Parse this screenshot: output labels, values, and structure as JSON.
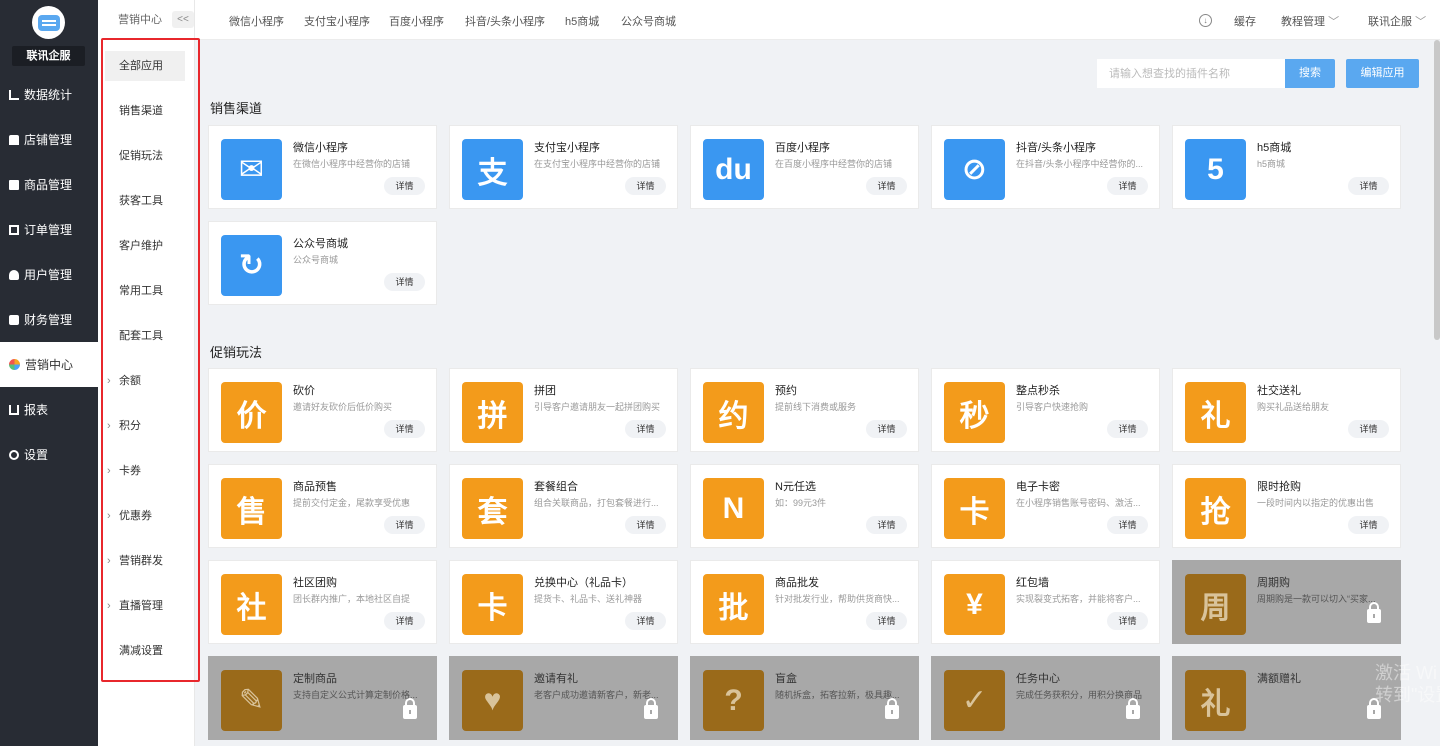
{
  "sidebar": {
    "brand": "联讯企服",
    "items": [
      {
        "label": "数据统计",
        "icon": "chart-icon",
        "cls": "ic-chart"
      },
      {
        "label": "店铺管理",
        "icon": "store-icon",
        "cls": "ic-store"
      },
      {
        "label": "商品管理",
        "icon": "goods-icon",
        "cls": "ic-box"
      },
      {
        "label": "订单管理",
        "icon": "order-icon",
        "cls": "ic-order"
      },
      {
        "label": "用户管理",
        "icon": "user-icon",
        "cls": "ic-user"
      },
      {
        "label": "财务管理",
        "icon": "finance-icon",
        "cls": "ic-fin"
      },
      {
        "label": "营销中心",
        "icon": "marketing-icon",
        "cls": "ic-mkt",
        "active": true
      },
      {
        "label": "报表",
        "icon": "report-icon",
        "cls": "ic-rep"
      },
      {
        "label": "设置",
        "icon": "settings-icon",
        "cls": "ic-set"
      }
    ]
  },
  "submenu": {
    "title": "营销中心",
    "collapse": "<<",
    "items": [
      {
        "label": "全部应用",
        "active": true
      },
      {
        "label": "销售渠道"
      },
      {
        "label": "促销玩法"
      },
      {
        "label": "获客工具"
      },
      {
        "label": "客户维护"
      },
      {
        "label": "常用工具"
      },
      {
        "label": "配套工具"
      },
      {
        "label": "余额",
        "expandable": true
      },
      {
        "label": "积分",
        "expandable": true
      },
      {
        "label": "卡券",
        "expandable": true
      },
      {
        "label": "优惠券",
        "expandable": true
      },
      {
        "label": "营销群发",
        "expandable": true
      },
      {
        "label": "直播管理",
        "expandable": true
      },
      {
        "label": "满减设置"
      }
    ]
  },
  "topbar": {
    "tabs": [
      "微信小程序",
      "支付宝小程序",
      "百度小程序",
      "抖音/头条小程序",
      "h5商城",
      "公众号商城"
    ],
    "cache": "缓存",
    "tutorial": "教程管理",
    "account": "联讯企服"
  },
  "toolbar": {
    "search_placeholder": "请输入想查找的插件名称",
    "search_label": "搜索",
    "edit_label": "编辑应用"
  },
  "sections": [
    {
      "title": "销售渠道",
      "cards": [
        {
          "name": "微信小程序",
          "desc": "在微信小程序中经营你的店铺",
          "color": "blue",
          "glyph": "✉"
        },
        {
          "name": "支付宝小程序",
          "desc": "在支付宝小程序中经营你的店铺",
          "color": "blue",
          "glyph": "支"
        },
        {
          "name": "百度小程序",
          "desc": "在百度小程序中经营你的店铺",
          "color": "blue",
          "glyph": "du"
        },
        {
          "name": "抖音/头条小程序",
          "desc": "在抖音/头条小程序中经营你的...",
          "color": "blue",
          "glyph": "⊘"
        },
        {
          "name": "h5商城",
          "desc": "h5商城",
          "color": "blue",
          "glyph": "5"
        },
        {
          "name": "公众号商城",
          "desc": "公众号商城",
          "color": "blue",
          "glyph": "↻"
        }
      ]
    },
    {
      "title": "促销玩法",
      "cards": [
        {
          "name": "砍价",
          "desc": "邀请好友砍价后低价购买",
          "color": "orange",
          "glyph": "价"
        },
        {
          "name": "拼团",
          "desc": "引导客户邀请朋友一起拼团购买",
          "color": "orange",
          "glyph": "拼"
        },
        {
          "name": "预约",
          "desc": "提前线下消费或服务",
          "color": "orange",
          "glyph": "约"
        },
        {
          "name": "整点秒杀",
          "desc": "引导客户快速抢购",
          "color": "orange",
          "glyph": "秒"
        },
        {
          "name": "社交送礼",
          "desc": "购买礼品送给朋友",
          "color": "orange",
          "glyph": "礼"
        },
        {
          "name": "商品预售",
          "desc": "提前交付定金，尾款享受优惠",
          "color": "orange",
          "glyph": "售"
        },
        {
          "name": "套餐组合",
          "desc": "组合关联商品，打包套餐进行...",
          "color": "orange",
          "glyph": "套"
        },
        {
          "name": "N元任选",
          "desc": "如：99元3件",
          "color": "orange",
          "glyph": "N"
        },
        {
          "name": "电子卡密",
          "desc": "在小程序销售账号密码、激活...",
          "color": "orange",
          "glyph": "卡"
        },
        {
          "name": "限时抢购",
          "desc": "一段时间内以指定的优惠出售",
          "color": "orange",
          "glyph": "抢"
        },
        {
          "name": "社区团购",
          "desc": "团长群内推广，本地社区自提",
          "color": "orange",
          "glyph": "社"
        },
        {
          "name": "兑换中心（礼品卡）",
          "desc": "提货卡、礼品卡、送礼神器",
          "color": "orange",
          "glyph": "卡"
        },
        {
          "name": "商品批发",
          "desc": "针对批发行业，帮助供货商快...",
          "color": "orange",
          "glyph": "批"
        },
        {
          "name": "红包墙",
          "desc": "实现裂变式拓客，并能将客户...",
          "color": "orange",
          "glyph": "¥"
        },
        {
          "name": "周期购",
          "desc": "周期购是一款可以切入“买家...",
          "color": "orange",
          "glyph": "周",
          "locked": true
        },
        {
          "name": "定制商品",
          "desc": "支持自定义公式计算定制价格...",
          "color": "orange",
          "glyph": "✎",
          "locked": true
        },
        {
          "name": "邀请有礼",
          "desc": "老客户成功邀请新客户，新老...",
          "color": "orange",
          "glyph": "♥",
          "locked": true
        },
        {
          "name": "盲盒",
          "desc": "随机拆盒，拓客拉新，极具趣...",
          "color": "orange",
          "glyph": "?",
          "locked": true
        },
        {
          "name": "任务中心",
          "desc": "完成任务获积分，用积分换商品",
          "color": "orange",
          "glyph": "✓",
          "locked": true
        },
        {
          "name": "满额赠礼",
          "desc": "",
          "color": "orange",
          "glyph": "礼",
          "locked": true
        }
      ]
    }
  ],
  "detail_label": "详情",
  "watermark": "激活 Wi\n转到\"设置\""
}
